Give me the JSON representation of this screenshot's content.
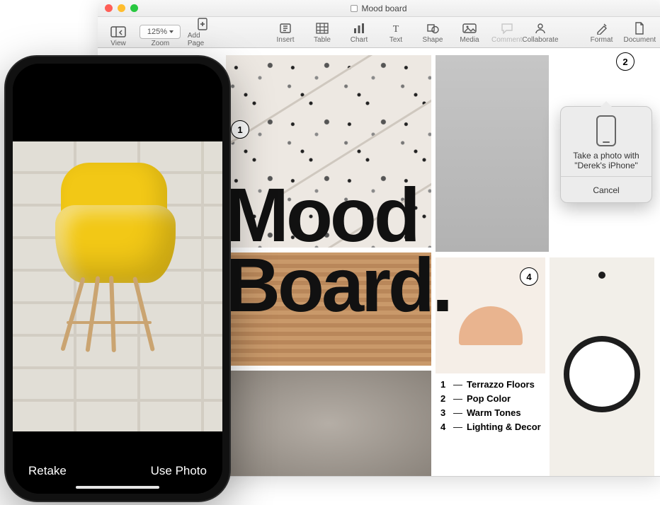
{
  "window": {
    "title": "Mood board"
  },
  "toolbar": {
    "view": "View",
    "zoom_label": "Zoom",
    "zoom_value": "125%",
    "add_page": "Add Page",
    "insert": "Insert",
    "table": "Table",
    "chart": "Chart",
    "text": "Text",
    "shape": "Shape",
    "media": "Media",
    "comment": "Comment",
    "collaborate": "Collaborate",
    "format": "Format",
    "document": "Document"
  },
  "canvas": {
    "hero_line1": "Mood",
    "hero_line2": "Board.",
    "callouts": {
      "c1": "1",
      "c2": "2",
      "c4": "4"
    },
    "legend": [
      {
        "n": "1",
        "label": "Terrazzo Floors"
      },
      {
        "n": "2",
        "label": "Pop Color"
      },
      {
        "n": "3",
        "label": "Warm Tones"
      },
      {
        "n": "4",
        "label": "Lighting & Decor"
      }
    ]
  },
  "popover": {
    "message_line1": "Take a photo with",
    "message_line2": "\"Derek's iPhone\"",
    "cancel": "Cancel"
  },
  "iphone": {
    "retake": "Retake",
    "use_photo": "Use Photo"
  }
}
